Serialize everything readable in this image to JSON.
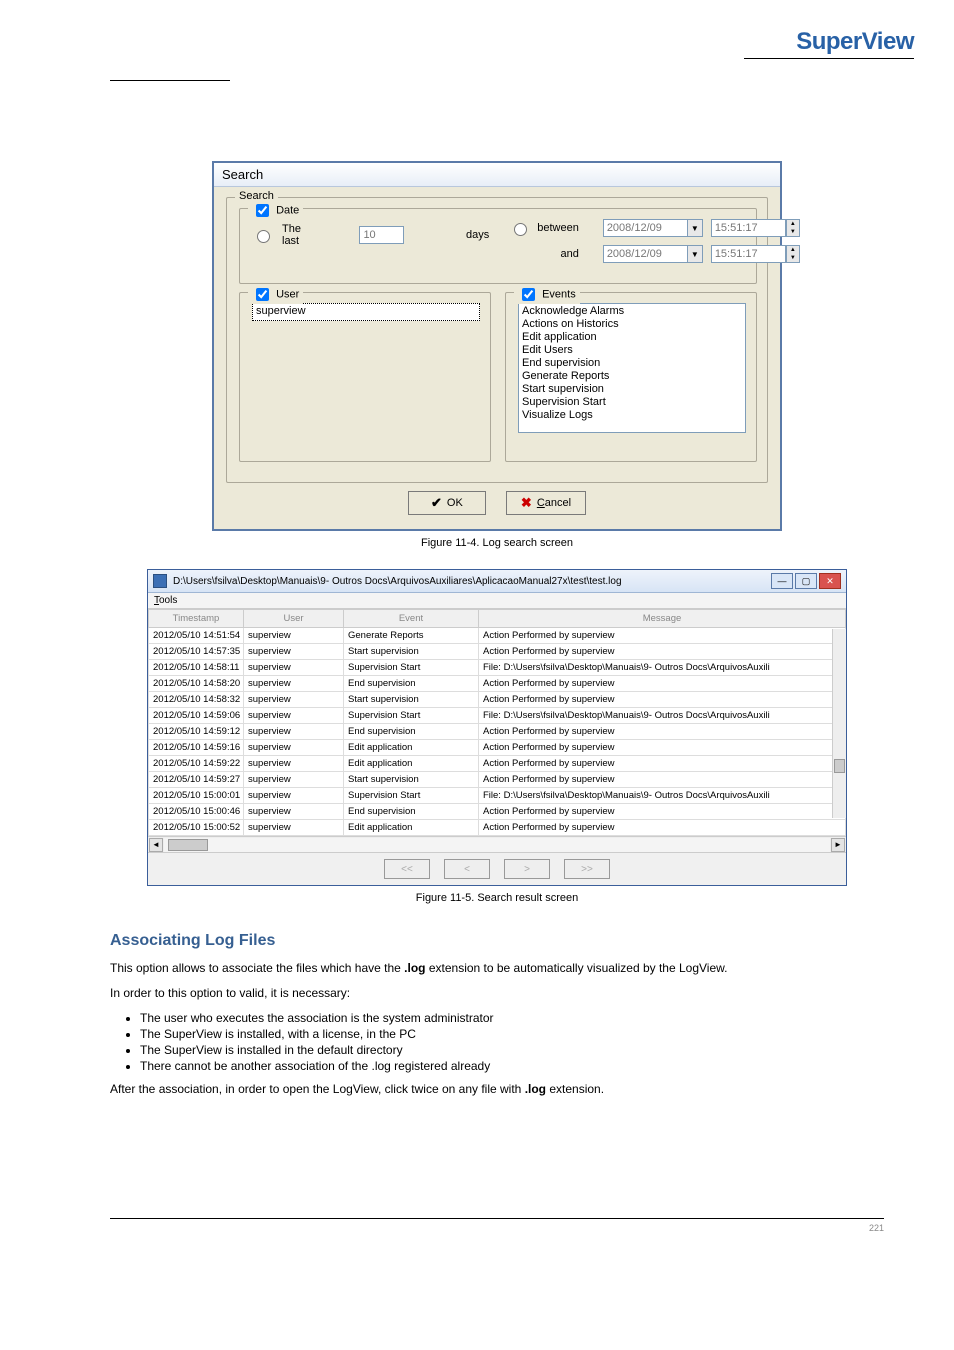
{
  "brand": "SuperView",
  "dialog": {
    "title": "Search",
    "group_label": "Search",
    "date": {
      "checkbox_label": "Date",
      "checked": true,
      "the_last_label": "The last",
      "the_last_value": "10",
      "days_label": "days",
      "between_label": "between",
      "and_label": "and",
      "date1": "2008/12/09",
      "time1": "15:51:17",
      "date2": "2008/12/09",
      "time2": "15:51:17"
    },
    "user": {
      "checkbox_label": "User",
      "checked": true,
      "value": "superview"
    },
    "events": {
      "checkbox_label": "Events",
      "checked": true,
      "items": [
        "Acknowledge Alarms",
        "Actions on Historics",
        "Edit application",
        "Edit Users",
        "End supervision",
        "Generate Reports",
        "Start supervision",
        "Supervision Start",
        "Visualize Logs"
      ]
    },
    "ok_label": "OK",
    "cancel_label": "Cancel",
    "cancel_underline": "C"
  },
  "caption1": "Figure 11-4. Log search screen",
  "logwin": {
    "path": "D:\\Users\\fsilva\\Desktop\\Manuais\\9- Outros Docs\\ArquivosAuxiliares\\AplicacaoManual27x\\test\\test.log",
    "menu_tools": "Tools",
    "menu_tools_ul": "T",
    "headers": {
      "ts": "Timestamp",
      "user": "User",
      "event": "Event",
      "msg": "Message"
    },
    "rows": [
      {
        "ts": "2012/05/10 14:51:54",
        "user": "superview",
        "event": "Generate Reports",
        "msg": "Action Performed by  superview"
      },
      {
        "ts": "2012/05/10 14:57:35",
        "user": "superview",
        "event": "Start supervision",
        "msg": "Action Performed by  superview"
      },
      {
        "ts": "2012/05/10 14:58:11",
        "user": "superview",
        "event": "Supervision Start",
        "msg": "File: D:\\Users\\fsilva\\Desktop\\Manuais\\9- Outros Docs\\ArquivosAuxili"
      },
      {
        "ts": "2012/05/10 14:58:20",
        "user": "superview",
        "event": "End supervision",
        "msg": "Action Performed by  superview"
      },
      {
        "ts": "2012/05/10 14:58:32",
        "user": "superview",
        "event": "Start supervision",
        "msg": "Action Performed by  superview"
      },
      {
        "ts": "2012/05/10 14:59:06",
        "user": "superview",
        "event": "Supervision Start",
        "msg": "File: D:\\Users\\fsilva\\Desktop\\Manuais\\9- Outros Docs\\ArquivosAuxili"
      },
      {
        "ts": "2012/05/10 14:59:12",
        "user": "superview",
        "event": "End supervision",
        "msg": "Action Performed by  superview"
      },
      {
        "ts": "2012/05/10 14:59:16",
        "user": "superview",
        "event": "Edit application",
        "msg": "Action Performed by  superview"
      },
      {
        "ts": "2012/05/10 14:59:22",
        "user": "superview",
        "event": "Edit application",
        "msg": "Action Performed by  superview"
      },
      {
        "ts": "2012/05/10 14:59:27",
        "user": "superview",
        "event": "Start supervision",
        "msg": "Action Performed by  superview"
      },
      {
        "ts": "2012/05/10 15:00:01",
        "user": "superview",
        "event": "Supervision Start",
        "msg": "File: D:\\Users\\fsilva\\Desktop\\Manuais\\9- Outros Docs\\ArquivosAuxili"
      },
      {
        "ts": "2012/05/10 15:00:46",
        "user": "superview",
        "event": "End supervision",
        "msg": "Action Performed by  superview"
      },
      {
        "ts": "2012/05/10 15:00:52",
        "user": "superview",
        "event": "Edit application",
        "msg": "Action Performed by  superview"
      }
    ],
    "pager": {
      "first": "<<",
      "prev": "<",
      "next": ">",
      "last": ">>"
    }
  },
  "caption2": "Figure 11-5. Search result screen",
  "section": {
    "title": "Associating Log Files",
    "p1_a": "This option allows to associate the files which have the ",
    "p1_b": ".log",
    "p1_c": " extension to be automatically visualized by the LogView.",
    "p2": "In order to this option to valid, it is necessary:",
    "bullets": [
      "The user who executes the association is the system administrator",
      "The SuperView is installed, with a license, in the PC",
      "The SuperView is installed in the default directory",
      "There cannot be another association of the .log registered already"
    ],
    "p3_a": "After the association, in order to open the LogView, click twice on any file with ",
    "p3_b": ".log",
    "p3_c": " extension."
  },
  "footer": "221"
}
